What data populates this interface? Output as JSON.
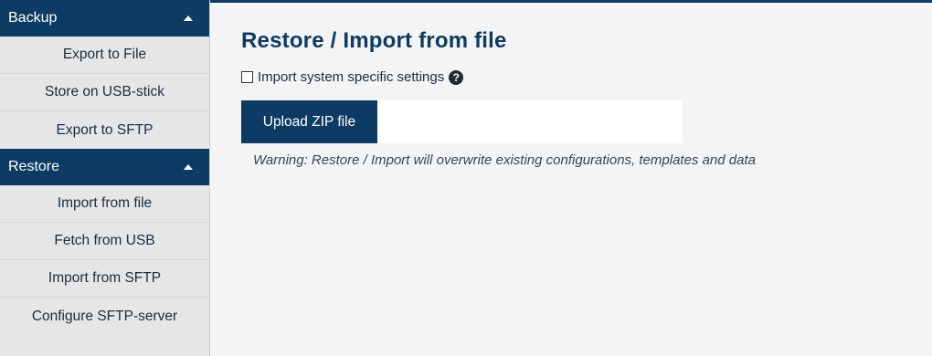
{
  "sidebar": {
    "sections": [
      {
        "header": "Backup",
        "items": [
          "Export to File",
          "Store on USB-stick",
          "Export to SFTP"
        ]
      },
      {
        "header": "Restore",
        "items": [
          "Import from file",
          "Fetch from USB",
          "Import from SFTP",
          "Configure SFTP-server"
        ]
      }
    ]
  },
  "main": {
    "title": "Restore / Import from file",
    "checkbox_label": "Import system specific settings",
    "help_icon_glyph": "?",
    "upload_label": "Upload ZIP file",
    "warning": "Warning: Restore / Import will overwrite existing configurations, templates and data"
  },
  "colors": {
    "accent": "#0c3b63",
    "sidebar_bg": "#e6e6e6",
    "page_bg": "#f4f4f4"
  },
  "icons": {
    "section_toggle": "caret-up-icon",
    "help": "question-circle-icon"
  }
}
